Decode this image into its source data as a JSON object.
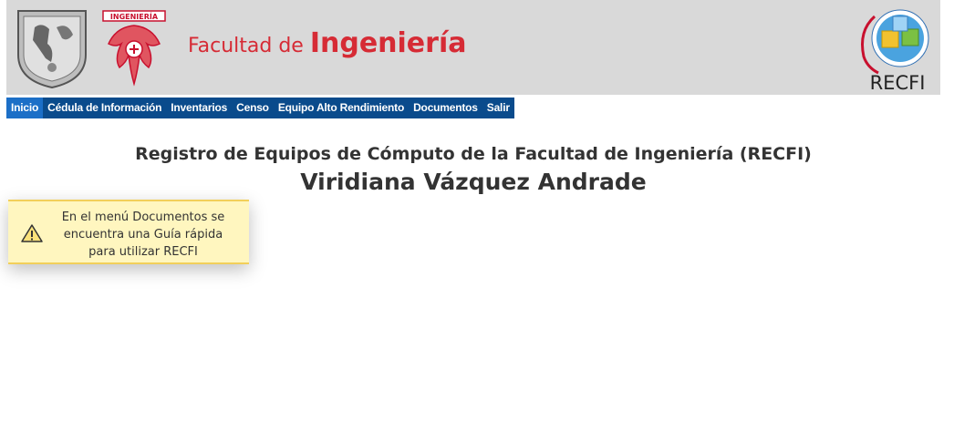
{
  "header": {
    "faculty_prefix": "Facultad de ",
    "faculty_main": "Ingeniería",
    "fi_logo_text": "INGENIERÍA",
    "recfi_logo_text": "RECFI",
    "brand_color": "#d62b35"
  },
  "nav": {
    "items": [
      {
        "label": "Inicio",
        "active": true
      },
      {
        "label": "Cédula de Información"
      },
      {
        "label": "Inventarios"
      },
      {
        "label": "Censo"
      },
      {
        "label": "Equipo Alto Rendimiento"
      },
      {
        "label": "Documentos"
      },
      {
        "label": "Salir"
      }
    ],
    "bg_color": "#0a4b8c",
    "active_color": "#1c6fc7"
  },
  "main": {
    "title": "Registro de Equipos de Cómputo de la Facultad de Ingeniería (RECFI)",
    "user_name": "Viridiana Vázquez Andrade"
  },
  "notice": {
    "icon": "warning-icon",
    "line1": "En el menú Documentos se",
    "line2": "encuentra una Guía rápida",
    "line3": "para utilizar RECFI"
  }
}
